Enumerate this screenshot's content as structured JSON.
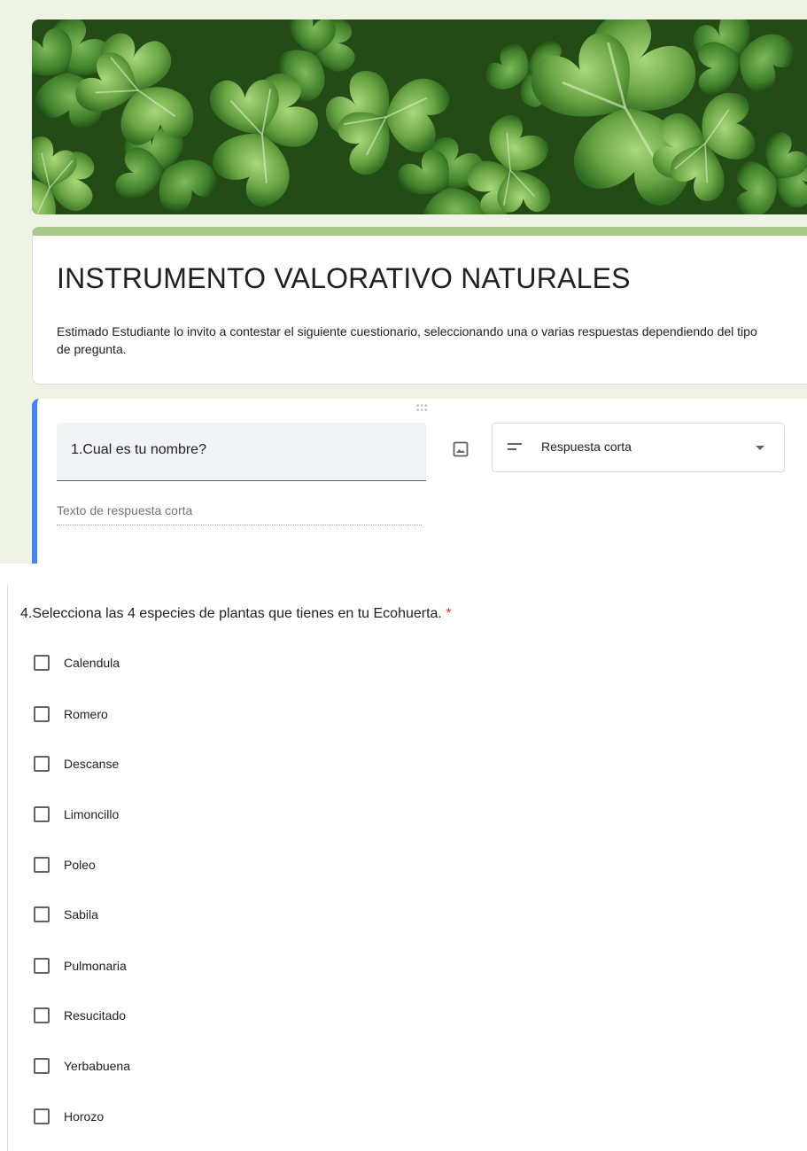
{
  "colors": {
    "accent": "#4285f4",
    "theme_bar": "#a8c98a",
    "required": "#d93025",
    "editor_bg": "#eef3e6"
  },
  "header": {
    "banner_image": "clover-leaves-photo"
  },
  "form": {
    "title": "INSTRUMENTO VALORATIVO NATURALES",
    "description": "Estimado Estudiante lo invito a contestar el siguiente cuestionario, seleccionando una o varias respuestas dependiendo del tipo de pregunta."
  },
  "question_editor": {
    "question_text": "1.Cual es tu nombre?",
    "type_icon": "short-answer-icon",
    "type_label": "Respuesta corta",
    "short_answer_placeholder": "Texto de respuesta corta",
    "image_icon": "image-icon",
    "drag_icon": "drag-handle-icon"
  },
  "question4": {
    "title": "4.Selecciona las 4 especies de plantas que tienes en tu Ecohuerta.",
    "required_mark": "*",
    "options": [
      {
        "label": "Calendula",
        "checked": false
      },
      {
        "label": "Romero",
        "checked": false
      },
      {
        "label": "Descanse",
        "checked": false
      },
      {
        "label": "Limoncillo",
        "checked": false
      },
      {
        "label": "Poleo",
        "checked": false
      },
      {
        "label": "Sabila",
        "checked": false
      },
      {
        "label": "Pulmonaria",
        "checked": false
      },
      {
        "label": "Resucitado",
        "checked": false
      },
      {
        "label": "Yerbabuena",
        "checked": false
      },
      {
        "label": "Horozo",
        "checked": false
      }
    ]
  }
}
